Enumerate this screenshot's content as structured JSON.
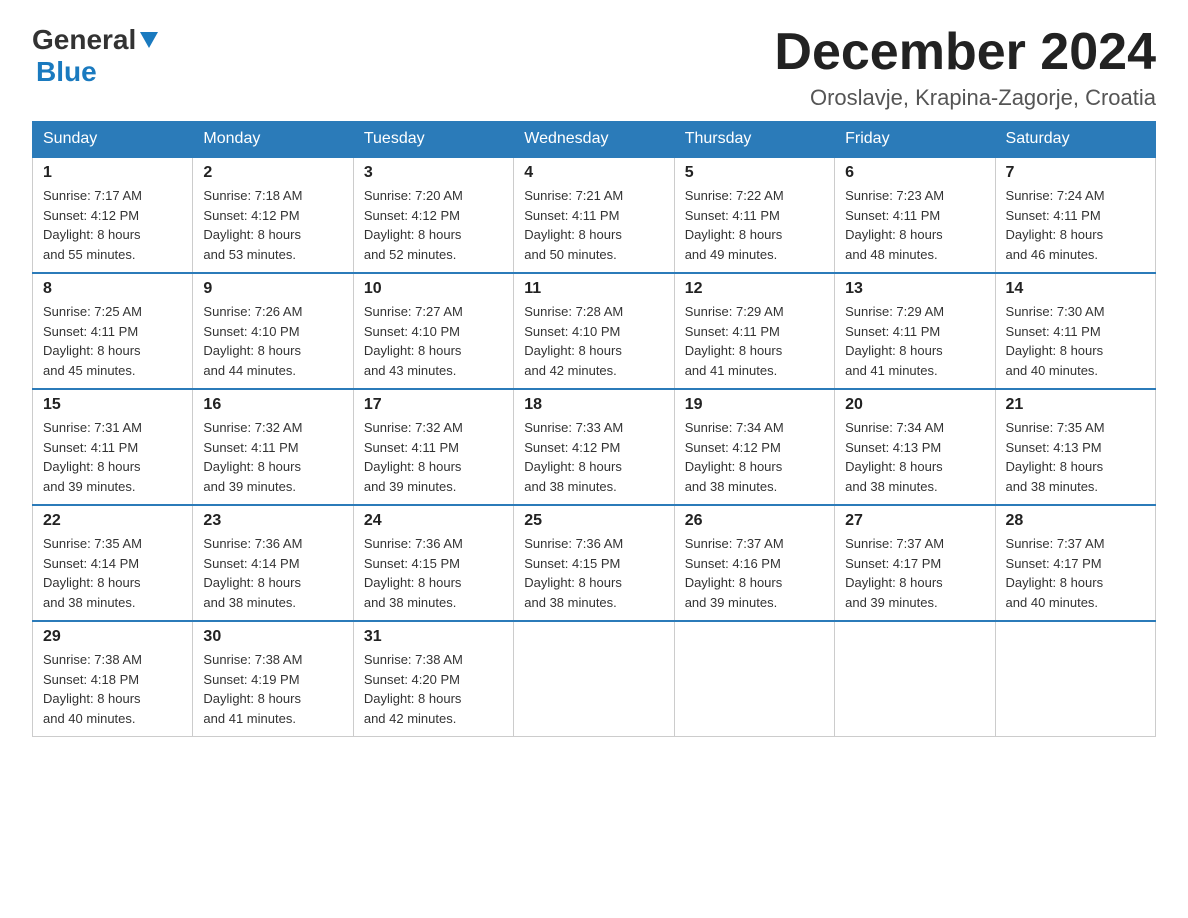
{
  "header": {
    "logo_general": "General",
    "logo_blue": "Blue",
    "month_title": "December 2024",
    "location": "Oroslavje, Krapina-Zagorje, Croatia"
  },
  "weekdays": [
    "Sunday",
    "Monday",
    "Tuesday",
    "Wednesday",
    "Thursday",
    "Friday",
    "Saturday"
  ],
  "weeks": [
    [
      {
        "day": "1",
        "sunrise": "7:17 AM",
        "sunset": "4:12 PM",
        "daylight": "8 hours and 55 minutes."
      },
      {
        "day": "2",
        "sunrise": "7:18 AM",
        "sunset": "4:12 PM",
        "daylight": "8 hours and 53 minutes."
      },
      {
        "day": "3",
        "sunrise": "7:20 AM",
        "sunset": "4:12 PM",
        "daylight": "8 hours and 52 minutes."
      },
      {
        "day": "4",
        "sunrise": "7:21 AM",
        "sunset": "4:11 PM",
        "daylight": "8 hours and 50 minutes."
      },
      {
        "day": "5",
        "sunrise": "7:22 AM",
        "sunset": "4:11 PM",
        "daylight": "8 hours and 49 minutes."
      },
      {
        "day": "6",
        "sunrise": "7:23 AM",
        "sunset": "4:11 PM",
        "daylight": "8 hours and 48 minutes."
      },
      {
        "day": "7",
        "sunrise": "7:24 AM",
        "sunset": "4:11 PM",
        "daylight": "8 hours and 46 minutes."
      }
    ],
    [
      {
        "day": "8",
        "sunrise": "7:25 AM",
        "sunset": "4:11 PM",
        "daylight": "8 hours and 45 minutes."
      },
      {
        "day": "9",
        "sunrise": "7:26 AM",
        "sunset": "4:10 PM",
        "daylight": "8 hours and 44 minutes."
      },
      {
        "day": "10",
        "sunrise": "7:27 AM",
        "sunset": "4:10 PM",
        "daylight": "8 hours and 43 minutes."
      },
      {
        "day": "11",
        "sunrise": "7:28 AM",
        "sunset": "4:10 PM",
        "daylight": "8 hours and 42 minutes."
      },
      {
        "day": "12",
        "sunrise": "7:29 AM",
        "sunset": "4:11 PM",
        "daylight": "8 hours and 41 minutes."
      },
      {
        "day": "13",
        "sunrise": "7:29 AM",
        "sunset": "4:11 PM",
        "daylight": "8 hours and 41 minutes."
      },
      {
        "day": "14",
        "sunrise": "7:30 AM",
        "sunset": "4:11 PM",
        "daylight": "8 hours and 40 minutes."
      }
    ],
    [
      {
        "day": "15",
        "sunrise": "7:31 AM",
        "sunset": "4:11 PM",
        "daylight": "8 hours and 39 minutes."
      },
      {
        "day": "16",
        "sunrise": "7:32 AM",
        "sunset": "4:11 PM",
        "daylight": "8 hours and 39 minutes."
      },
      {
        "day": "17",
        "sunrise": "7:32 AM",
        "sunset": "4:11 PM",
        "daylight": "8 hours and 39 minutes."
      },
      {
        "day": "18",
        "sunrise": "7:33 AM",
        "sunset": "4:12 PM",
        "daylight": "8 hours and 38 minutes."
      },
      {
        "day": "19",
        "sunrise": "7:34 AM",
        "sunset": "4:12 PM",
        "daylight": "8 hours and 38 minutes."
      },
      {
        "day": "20",
        "sunrise": "7:34 AM",
        "sunset": "4:13 PM",
        "daylight": "8 hours and 38 minutes."
      },
      {
        "day": "21",
        "sunrise": "7:35 AM",
        "sunset": "4:13 PM",
        "daylight": "8 hours and 38 minutes."
      }
    ],
    [
      {
        "day": "22",
        "sunrise": "7:35 AM",
        "sunset": "4:14 PM",
        "daylight": "8 hours and 38 minutes."
      },
      {
        "day": "23",
        "sunrise": "7:36 AM",
        "sunset": "4:14 PM",
        "daylight": "8 hours and 38 minutes."
      },
      {
        "day": "24",
        "sunrise": "7:36 AM",
        "sunset": "4:15 PM",
        "daylight": "8 hours and 38 minutes."
      },
      {
        "day": "25",
        "sunrise": "7:36 AM",
        "sunset": "4:15 PM",
        "daylight": "8 hours and 38 minutes."
      },
      {
        "day": "26",
        "sunrise": "7:37 AM",
        "sunset": "4:16 PM",
        "daylight": "8 hours and 39 minutes."
      },
      {
        "day": "27",
        "sunrise": "7:37 AM",
        "sunset": "4:17 PM",
        "daylight": "8 hours and 39 minutes."
      },
      {
        "day": "28",
        "sunrise": "7:37 AM",
        "sunset": "4:17 PM",
        "daylight": "8 hours and 40 minutes."
      }
    ],
    [
      {
        "day": "29",
        "sunrise": "7:38 AM",
        "sunset": "4:18 PM",
        "daylight": "8 hours and 40 minutes."
      },
      {
        "day": "30",
        "sunrise": "7:38 AM",
        "sunset": "4:19 PM",
        "daylight": "8 hours and 41 minutes."
      },
      {
        "day": "31",
        "sunrise": "7:38 AM",
        "sunset": "4:20 PM",
        "daylight": "8 hours and 42 minutes."
      },
      null,
      null,
      null,
      null
    ]
  ],
  "labels": {
    "sunrise": "Sunrise:",
    "sunset": "Sunset:",
    "daylight": "Daylight:"
  }
}
